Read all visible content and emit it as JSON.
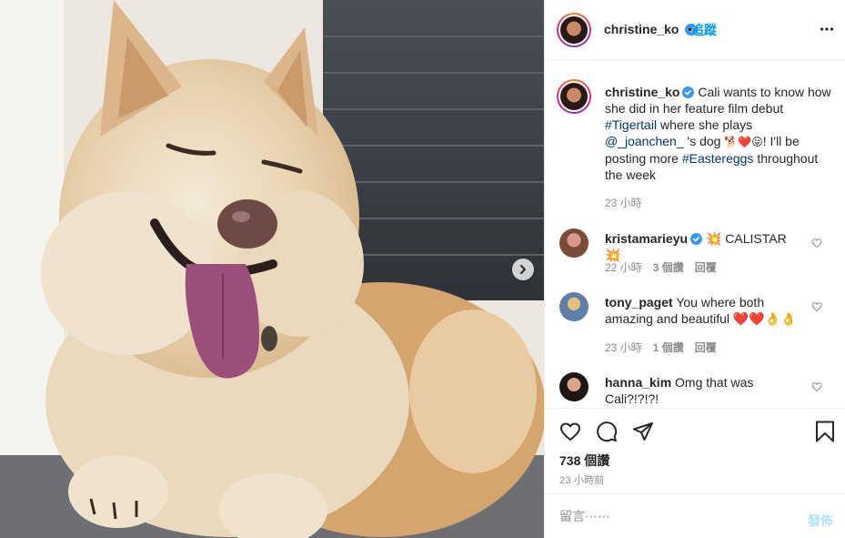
{
  "post": {
    "author": "christine_ko",
    "follow_label": "追蹤",
    "dot": "•",
    "caption": {
      "text_1": "Cali wants to know how she did in her feature film debut",
      "hashtag_1": "#Tigertail",
      "text_2": "where she plays",
      "mention": "@_joanchen_",
      "text_3": "'s dog",
      "emoji": "🐕❤️😛",
      "text_4": "! I'll be posting more",
      "hashtag_2": "#Eastereggs",
      "text_5": "throughout the week",
      "time": "23 小時"
    },
    "comments": [
      {
        "user": "kristamarieyu",
        "verified": true,
        "text": "💥 CALISTAR 💥",
        "time": "22 小時",
        "likes": "3 個讚",
        "reply": "回覆"
      },
      {
        "user": "tony_paget",
        "verified": false,
        "text": "You where both amazing and beautiful ❤️❤️👌👌",
        "time": "23 小時",
        "likes": "1 個讚",
        "reply": "回覆"
      },
      {
        "user": "hanna_kim",
        "verified": false,
        "text": "Omg that was Cali?!?!?!",
        "time": "",
        "likes": "",
        "reply": ""
      }
    ],
    "likes_count": "738 個讚",
    "posted_time": "23 小時前",
    "add_comment_placeholder": "留言⋯⋯",
    "post_button": "發佈"
  },
  "icons": {
    "verified": "verified-badge-icon",
    "more": "more-options-icon",
    "like": "heart-icon",
    "comment": "comment-icon",
    "share": "share-icon",
    "save": "bookmark-icon",
    "next": "chevron-right-icon"
  },
  "colors": {
    "accent": "#0095f6",
    "verified": "#3897f0",
    "text": "#262626",
    "muted": "#8e8e8e",
    "post_disabled": "#b2dffc"
  }
}
